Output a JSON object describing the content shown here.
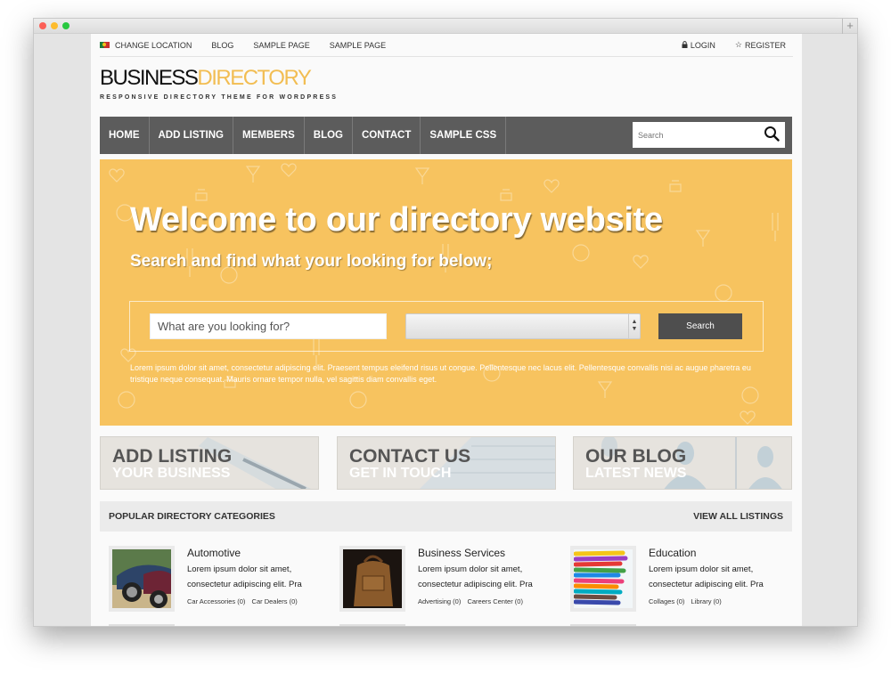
{
  "browser": {
    "new_tab_label": "+"
  },
  "topbar": {
    "left_items": [
      {
        "label": "CHANGE LOCATION",
        "icon": "flag-icon"
      },
      {
        "label": "BLOG"
      },
      {
        "label": "SAMPLE PAGE"
      },
      {
        "label": "SAMPLE PAGE"
      }
    ],
    "login_label": "LOGIN",
    "login_icon": "lock-icon",
    "register_label": "REGISTER",
    "register_icon": "star-icon"
  },
  "logo": {
    "word1": "BUSINESS",
    "word2": "DIRECTORY",
    "tagline": "RESPONSIVE DIRECTORY THEME FOR WORDPRESS",
    "accent_color": "#f2bd52"
  },
  "nav": {
    "items": [
      "HOME",
      "ADD LISTING",
      "MEMBERS",
      "BLOG",
      "CONTACT",
      "SAMPLE CSS"
    ],
    "search_placeholder": "Search",
    "background_color": "#5c5c5c"
  },
  "hero": {
    "title": "Welcome to our directory website",
    "subtitle": "Search and find what your looking for below;",
    "search_placeholder": "What are you looking for?",
    "select_value": "",
    "search_button": "Search",
    "description": "Lorem ipsum dolor sit amet, consectetur adipiscing elit. Praesent tempus eleifend risus ut congue. Pellentesque nec lacus elit. Pellentesque convallis nisi ac augue pharetra eu tristique neque consequat. Mauris ornare tempor nulla, vel sagittis diam convallis eget.",
    "background_color": "#f7c35f"
  },
  "promos": [
    {
      "title": "ADD LISTING",
      "subtitle": "YOUR BUSINESS"
    },
    {
      "title": "CONTACT US",
      "subtitle": "GET IN TOUCH"
    },
    {
      "title": "OUR BLOG",
      "subtitle": "LATEST NEWS"
    }
  ],
  "categories_section": {
    "heading": "POPULAR DIRECTORY CATEGORIES",
    "view_all": "VIEW ALL LISTINGS",
    "items": [
      {
        "title": "Automotive",
        "description": "Lorem ipsum dolor sit amet, consectetur adipiscing elit. Pra",
        "sublinks": [
          "Car Accessories (0)",
          "Car Dealers (0)"
        ]
      },
      {
        "title": "Business Services",
        "description": "Lorem ipsum dolor sit amet, consectetur adipiscing elit. Pra",
        "sublinks": [
          "Advertising (0)",
          "Careers Center (0)"
        ]
      },
      {
        "title": "Education",
        "description": "Lorem ipsum dolor sit amet, consectetur adipiscing elit. Pra",
        "sublinks": [
          "Collages (0)",
          "Library (0)"
        ]
      }
    ]
  }
}
